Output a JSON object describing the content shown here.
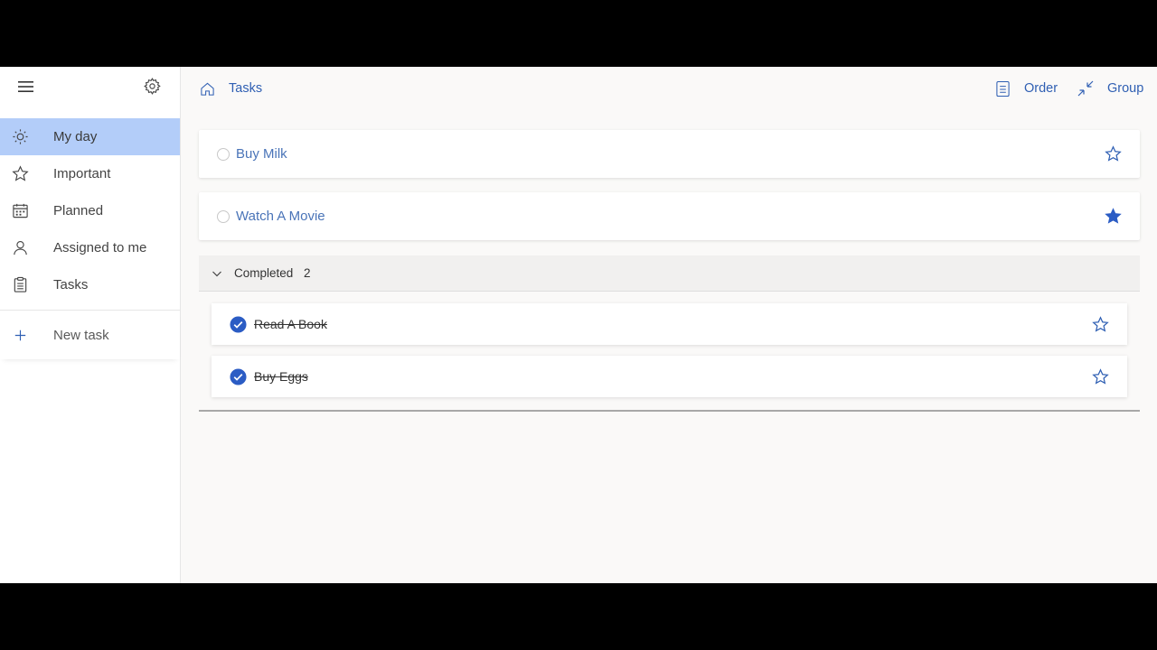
{
  "sidebar": {
    "items": [
      {
        "label": "My day",
        "icon": "sun-icon",
        "active": true
      },
      {
        "label": "Important",
        "icon": "star-icon"
      },
      {
        "label": "Planned",
        "icon": "calendar-icon"
      },
      {
        "label": "Assigned to me",
        "icon": "person-icon"
      },
      {
        "label": "Tasks",
        "icon": "clipboard-icon"
      }
    ],
    "new_task_label": "New task"
  },
  "header": {
    "breadcrumb": "Tasks",
    "order_label": "Order",
    "group_label": "Group"
  },
  "tasks": [
    {
      "title": "Buy Milk",
      "important": false
    },
    {
      "title": "Watch A Movie",
      "important": true
    }
  ],
  "completed": {
    "label": "Completed",
    "count": "2",
    "items": [
      {
        "title": "Read A Book",
        "important": false
      },
      {
        "title": "Buy Eggs",
        "important": false
      }
    ]
  },
  "colors": {
    "accent": "#2f5fb3",
    "active_nav": "#b3cdf9",
    "check": "#2b5cc4"
  }
}
